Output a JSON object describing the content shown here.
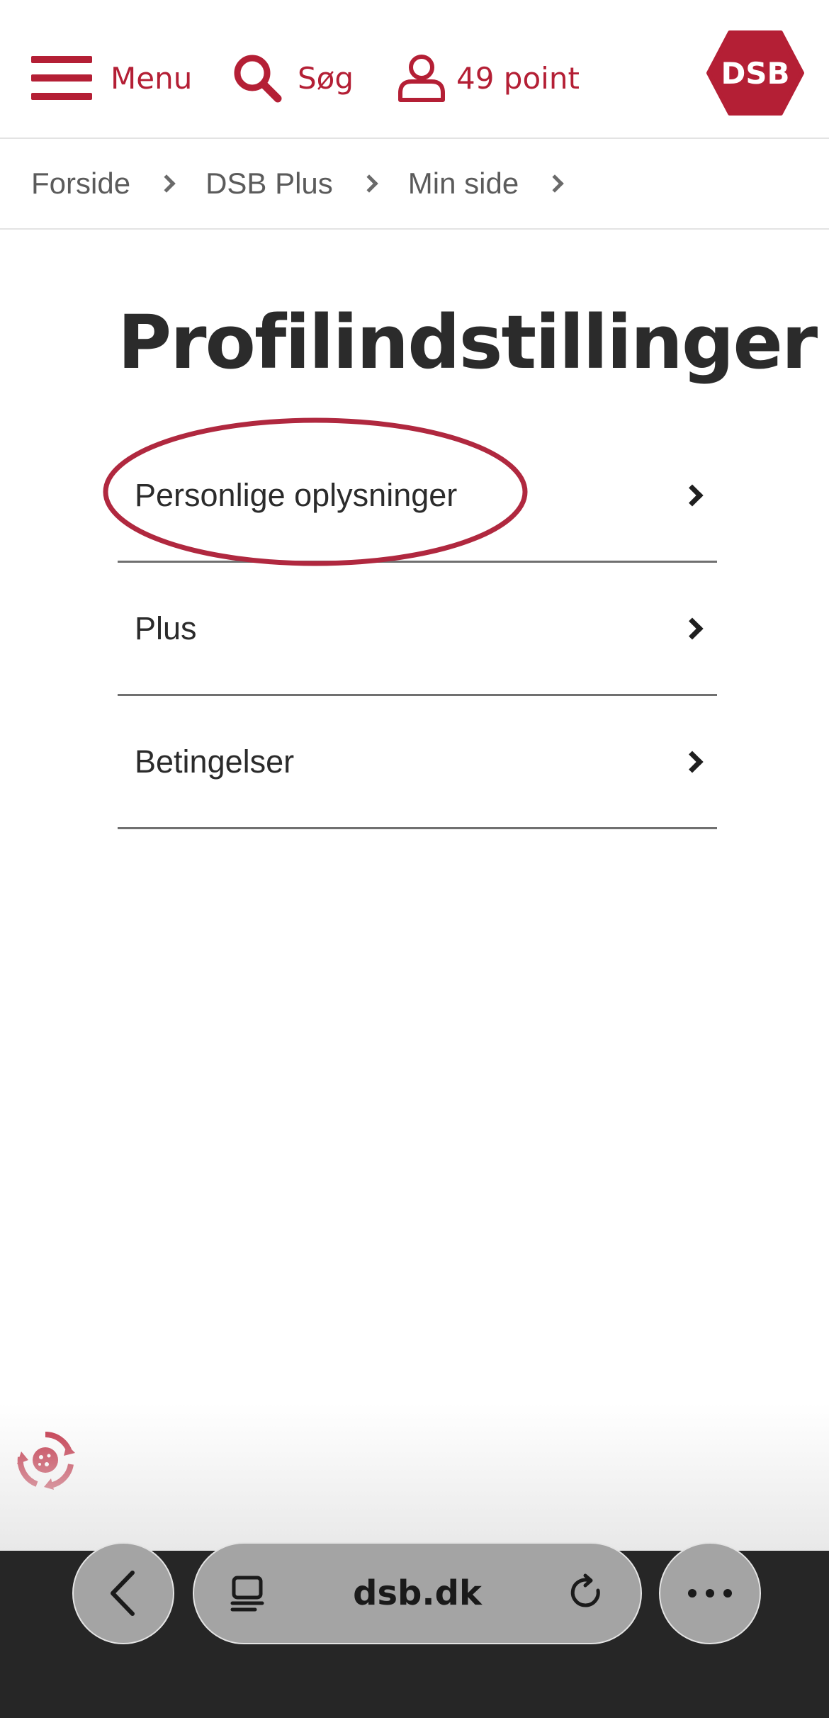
{
  "header": {
    "menu_label": "Menu",
    "search_label": "Søg",
    "points_label": "49 point",
    "logo_text": "DSB"
  },
  "breadcrumb": [
    "Forside",
    "DSB Plus",
    "Min side"
  ],
  "page": {
    "title": "Profilindstillinger",
    "items": [
      {
        "label": "Personlige oplysninger"
      },
      {
        "label": "Plus"
      },
      {
        "label": "Betingelser"
      }
    ]
  },
  "browser": {
    "address": "dsb.dk"
  },
  "icons": {
    "menu": "hamburger-icon",
    "search": "search-icon",
    "account": "user-icon",
    "chevron": "chevron-right-icon",
    "back": "back-arrow-icon",
    "tabs": "tabs-icon",
    "reload": "reload-icon",
    "more": "more-dots-icon",
    "widget": "cookie-settings-icon"
  },
  "colors": {
    "brand_red": "#b41f35",
    "text_dark": "#2b2b2b",
    "highlight": "#b0283f"
  }
}
